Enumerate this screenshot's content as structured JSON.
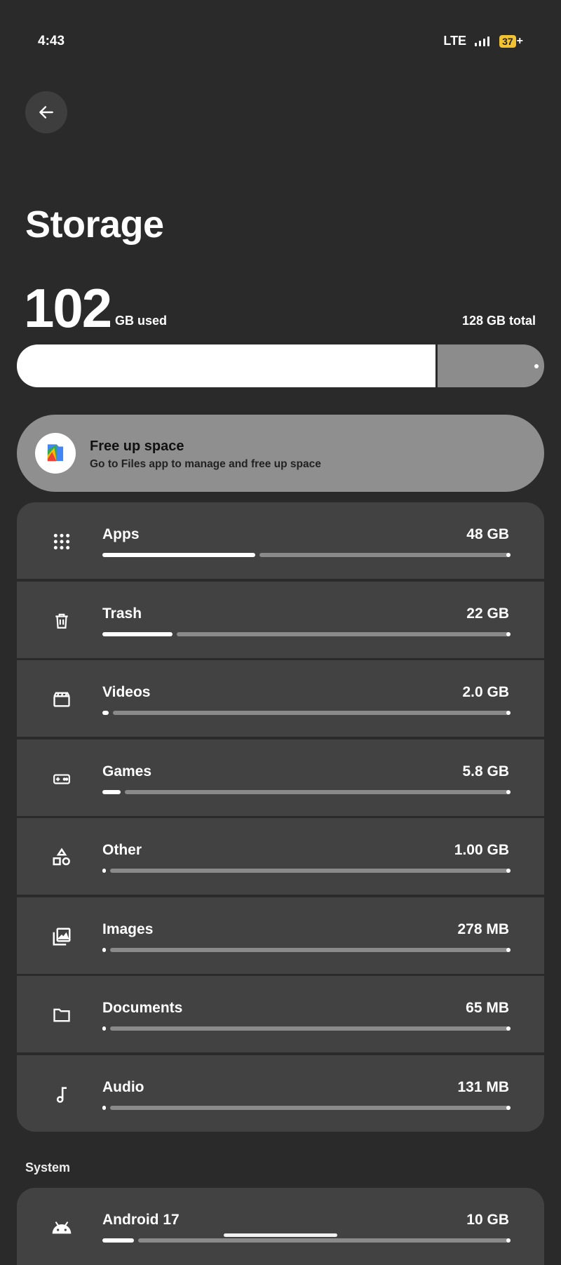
{
  "status_bar": {
    "time": "4:43",
    "network": "LTE",
    "battery": "37",
    "battery_suffix": "+"
  },
  "header": {
    "title": "Storage"
  },
  "summary": {
    "used_value": "102",
    "used_unit": "GB used",
    "total_label": "128 GB total",
    "used_fraction": 0.797
  },
  "free_up": {
    "title": "Free up space",
    "subtitle": "Go to Files app to manage and free up space"
  },
  "categories": [
    {
      "label": "Apps",
      "size": "48 GB",
      "icon": "apps-grid-icon",
      "fraction": 0.375
    },
    {
      "label": "Trash",
      "size": "22 GB",
      "icon": "trash-icon",
      "fraction": 0.172
    },
    {
      "label": "Videos",
      "size": "2.0 GB",
      "icon": "video-clapper-icon",
      "fraction": 0.016
    },
    {
      "label": "Games",
      "size": "5.8 GB",
      "icon": "gamepad-icon",
      "fraction": 0.045
    },
    {
      "label": "Other",
      "size": "1.00 GB",
      "icon": "shapes-icon",
      "fraction": 0.008
    },
    {
      "label": "Images",
      "size": "278 MB",
      "icon": "image-gallery-icon",
      "fraction": 0.002
    },
    {
      "label": "Documents",
      "size": "65 MB",
      "icon": "folder-icon",
      "fraction": 0.0005
    },
    {
      "label": "Audio",
      "size": "131 MB",
      "icon": "music-note-icon",
      "fraction": 0.001
    }
  ],
  "system": {
    "section_label": "System",
    "items": [
      {
        "label": "Android 17",
        "size": "10 GB",
        "icon": "android-icon",
        "fraction": 0.078
      }
    ]
  },
  "colors": {
    "background": "#2a2a2a",
    "row_background": "#424242",
    "bar_fill": "#ffffff",
    "bar_track": "#8a8a8a",
    "free_up_card": "#8f8f8f",
    "battery": "#f1c232"
  }
}
